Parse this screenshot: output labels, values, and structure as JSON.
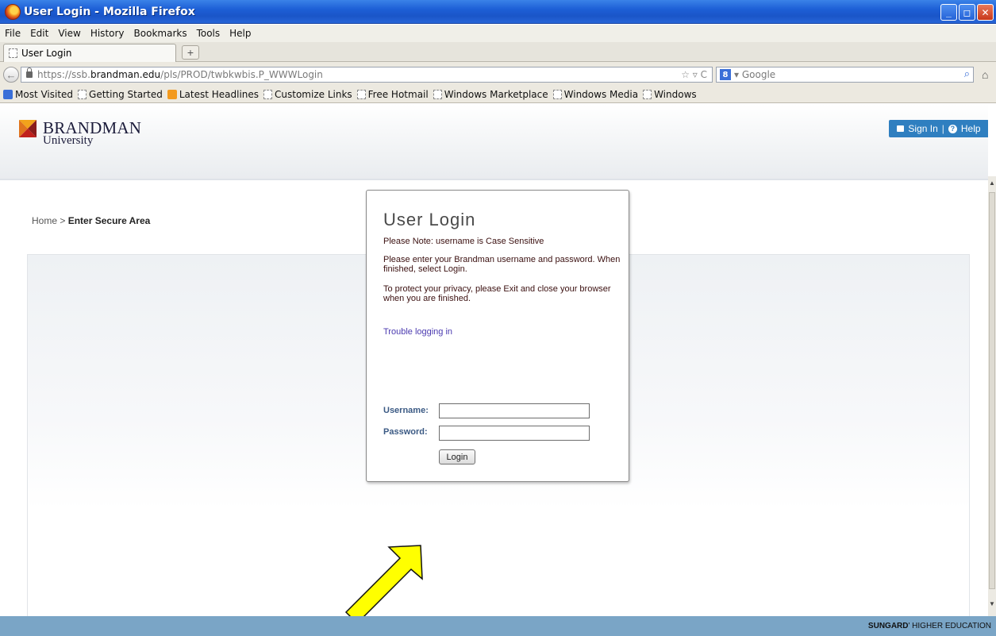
{
  "window": {
    "title": "User Login - Mozilla Firefox",
    "buttons": {
      "minimize": "_",
      "maximize": "◻",
      "close": "✕"
    }
  },
  "menu": [
    "File",
    "Edit",
    "View",
    "History",
    "Bookmarks",
    "Tools",
    "Help"
  ],
  "tab": {
    "label": "User Login",
    "new_tab": "+"
  },
  "nav": {
    "back": "←",
    "url_prefix": "https://ssb.",
    "url_domain": "brandman.edu",
    "url_path": "/pls/PROD/twbkwbis.P_WWWLogin",
    "url_controls": "☆ ▿ C",
    "search_engine_badge": "8",
    "search_placeholder": "▾ Google",
    "search_icon": "⌕",
    "home_icon": "⌂"
  },
  "bookmarks": [
    "Most Visited",
    "Getting Started",
    "Latest Headlines",
    "Customize Links",
    "Free Hotmail",
    "Windows Marketplace",
    "Windows Media",
    "Windows"
  ],
  "site": {
    "logo_name": "BRANDMAN",
    "logo_sub": "University",
    "sign_in": "Sign In",
    "help": "Help",
    "help_glyph": "?",
    "separator": "|"
  },
  "breadcrumb": {
    "home": "Home",
    "separator": ">",
    "current": "Enter Secure Area"
  },
  "login": {
    "title": "User Login",
    "note": "Please Note: username is Case Sensitive",
    "instructions": "Please enter your Brandman username and password. When finished, select Login.",
    "privacy": "To protect your privacy, please Exit and close your browser when you are finished.",
    "trouble_link": "Trouble logging in",
    "username_label": "Username:",
    "password_label": "Password:",
    "username_value": "",
    "password_value": "",
    "button": "Login"
  },
  "scrollbar": {
    "up": "▲",
    "down": "▼"
  },
  "footer": {
    "brand_bold": "SUNGARD",
    "brand_rest": "' HIGHER EDUCATION"
  },
  "colors": {
    "titlebar": "#1d5fd6",
    "accent_button": "#2f7fc0",
    "footer": "#7aa5c6",
    "arrow": "#ffff00"
  }
}
